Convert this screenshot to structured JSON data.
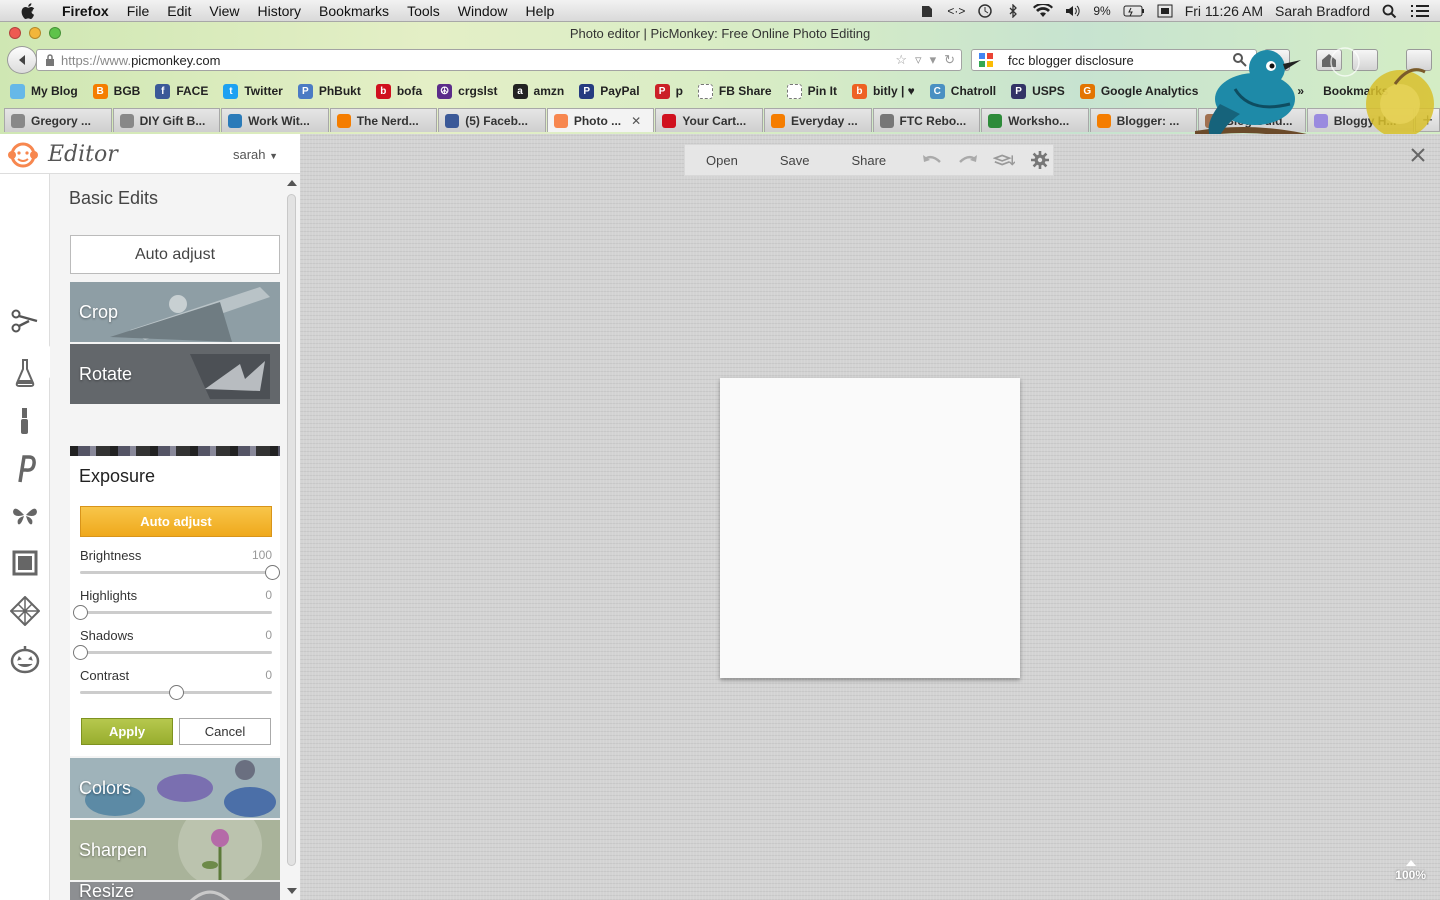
{
  "menubar": {
    "app_name": "Firefox",
    "items": [
      "File",
      "Edit",
      "View",
      "History",
      "Bookmarks",
      "Tools",
      "Window",
      "Help"
    ],
    "battery": "9%",
    "clock": "Fri 11:26 AM",
    "user": "Sarah Bradford"
  },
  "window": {
    "title": "Photo editor | PicMonkey: Free Online Photo Editing"
  },
  "urlbar": {
    "protocol": "https://www.",
    "domain": "picmonkey.com"
  },
  "searchbar": {
    "query": "fcc blogger disclosure"
  },
  "bookmarks": [
    {
      "label": "My Blog",
      "color": "#66b8e8",
      "glyph": ""
    },
    {
      "label": "BGB",
      "color": "#f57d00",
      "glyph": "B"
    },
    {
      "label": "FACE",
      "color": "#3b5998",
      "glyph": "f"
    },
    {
      "label": "Twitter",
      "color": "#1da1f2",
      "glyph": "t"
    },
    {
      "label": "PhBukt",
      "color": "#4b7bc4",
      "glyph": "P"
    },
    {
      "label": "bofa",
      "color": "#d0101e",
      "glyph": "b"
    },
    {
      "label": "crgslst",
      "color": "#5b2c8a",
      "glyph": "☮"
    },
    {
      "label": "amzn",
      "color": "#222222",
      "glyph": "a"
    },
    {
      "label": "PayPal",
      "color": "#253b80",
      "glyph": "P"
    },
    {
      "label": "p",
      "color": "#cb2027",
      "glyph": "P"
    },
    {
      "label": "FB Share",
      "color": "#ffffff",
      "glyph": ""
    },
    {
      "label": "Pin It",
      "color": "#ffffff",
      "glyph": ""
    },
    {
      "label": "bitly | ♥",
      "color": "#ee6123",
      "glyph": "b"
    },
    {
      "label": "Chatroll",
      "color": "#4a90c2",
      "glyph": "C"
    },
    {
      "label": "USPS",
      "color": "#333366",
      "glyph": "P"
    },
    {
      "label": "Google Analytics",
      "color": "#e37400",
      "glyph": "G"
    }
  ],
  "bookmarks_overflow": "»",
  "bookmarks_menu": "Bookmarks",
  "tabs": [
    {
      "label": "Gregory ...",
      "color": "#888888"
    },
    {
      "label": "DIY Gift B...",
      "color": "#888888"
    },
    {
      "label": "Work Wit...",
      "color": "#2b7bb9"
    },
    {
      "label": "The Nerd...",
      "color": "#f57d00"
    },
    {
      "label": "(5) Faceb...",
      "color": "#3b5998"
    },
    {
      "label": "Photo ...",
      "color": "#f7874f",
      "active": true
    },
    {
      "label": "Your Cart...",
      "color": "#d0101e"
    },
    {
      "label": "Everyday ...",
      "color": "#f57d00"
    },
    {
      "label": "FTC Rebo...",
      "color": "#777777"
    },
    {
      "label": "Worksho...",
      "color": "#2e8b3a"
    },
    {
      "label": "Blogger: ...",
      "color": "#f57d00"
    },
    {
      "label": "Blog Guid...",
      "color": "#a07050"
    },
    {
      "label": "Bloggy H...",
      "color": "#9a8adf"
    }
  ],
  "editor": {
    "title": "Editor",
    "user": "sarah",
    "panel_title": "Basic Edits",
    "auto_adjust": "Auto adjust",
    "tiles_top": [
      "Crop",
      "Rotate"
    ],
    "tiles_bottom": [
      "Colors",
      "Sharpen",
      "Resize"
    ],
    "exposure": {
      "title": "Exposure",
      "auto_adjust": "Auto adjust",
      "sliders": [
        {
          "label": "Brightness",
          "value": "100",
          "position": 1.0
        },
        {
          "label": "Highlights",
          "value": "0",
          "position": 0.0
        },
        {
          "label": "Shadows",
          "value": "0",
          "position": 0.0
        },
        {
          "label": "Contrast",
          "value": "0",
          "position": 0.5
        }
      ],
      "apply": "Apply",
      "cancel": "Cancel"
    },
    "toolbar": {
      "open": "Open",
      "save": "Save",
      "share": "Share"
    },
    "zoom": "100%"
  },
  "colors": {
    "apply": "#a4b83c",
    "auto_adjust": "#f3b42f",
    "canvas_bg": "#d3d3d3",
    "logo": "#f7874f"
  }
}
